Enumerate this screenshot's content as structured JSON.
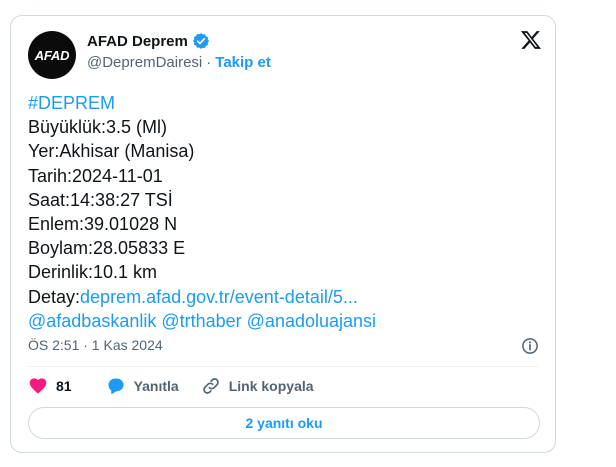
{
  "author": {
    "avatar_text": "AFAD",
    "display_name": "AFAD Deprem",
    "handle": "@DepremDairesi",
    "separator": "·",
    "follow_label": "Takip et"
  },
  "tweet": {
    "hashtag": "#DEPREM",
    "lines": [
      "Büyüklük:3.5 (Ml)",
      "Yer:Akhisar (Manisa)",
      "Tarih:2024-11-01",
      "Saat:14:38:27 TSİ",
      "Enlem:39.01028 N",
      "Boylam:28.05833 E",
      "Derinlik:10.1 km"
    ],
    "detail_label": "Detay:",
    "detail_link": "deprem.afad.gov.tr/event-detail/5...",
    "mentions": "@afadbaskanlik @trthaber @anadoluajansi"
  },
  "meta": {
    "timestamp": "ÖS 2:51 · 1 Kas 2024"
  },
  "actions": {
    "likes": "81",
    "reply_label": "Yanıtla",
    "copy_link_label": "Link kopyala"
  },
  "read_replies_label": "2 yanıtı oku",
  "colors": {
    "accent": "#1d9bf0",
    "like": "#f91880",
    "text": "#0f1419",
    "muted": "#536471",
    "border": "#cfd9de"
  }
}
